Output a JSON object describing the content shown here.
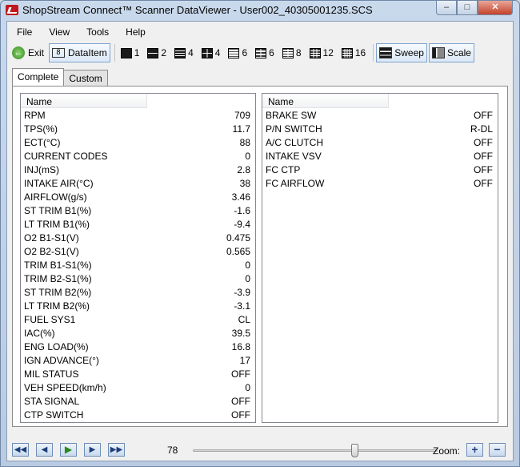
{
  "window": {
    "title": "ShopStream Connect™ Scanner DataViewer - User002_40305001235.SCS",
    "min_glyph": "‒",
    "max_glyph": "□",
    "close_glyph": "✕"
  },
  "menu": [
    "File",
    "View",
    "Tools",
    "Help"
  ],
  "toolbar": {
    "exit_label": "Exit",
    "dataitem_label": "DataItem",
    "layouts": [
      {
        "label": "1",
        "icon": "single-graph-icon"
      },
      {
        "label": "2",
        "icon": "two-graph-icon"
      },
      {
        "label": "4",
        "icon": "four-row-graph-icon"
      },
      {
        "label": "4",
        "icon": "four-grid-graph-icon"
      },
      {
        "label": "6",
        "icon": "six-row-graph-icon"
      },
      {
        "label": "6",
        "icon": "six-grid-graph-icon"
      },
      {
        "label": "8",
        "icon": "eight-grid-graph-icon"
      },
      {
        "label": "12",
        "icon": "twelve-grid-graph-icon"
      },
      {
        "label": "16",
        "icon": "sixteen-grid-graph-icon"
      }
    ],
    "sweep_label": "Sweep",
    "scale_label": "Scale"
  },
  "tabs": [
    "Complete",
    "Custom"
  ],
  "left_panel": {
    "header": "Name",
    "rows": [
      {
        "name": "RPM",
        "value": "709"
      },
      {
        "name": "TPS(%)",
        "value": "11.7"
      },
      {
        "name": "ECT(°C)",
        "value": "88"
      },
      {
        "name": "CURRENT CODES",
        "value": "0"
      },
      {
        "name": "INJ(mS)",
        "value": "2.8"
      },
      {
        "name": "INTAKE AIR(°C)",
        "value": "38"
      },
      {
        "name": "AIRFLOW(g/s)",
        "value": "3.46"
      },
      {
        "name": "ST TRIM B1(%)",
        "value": "-1.6"
      },
      {
        "name": "LT TRIM B1(%)",
        "value": "-9.4"
      },
      {
        "name": "O2 B1-S1(V)",
        "value": "0.475"
      },
      {
        "name": "O2 B2-S1(V)",
        "value": "0.565"
      },
      {
        "name": "TRIM B1-S1(%)",
        "value": "0"
      },
      {
        "name": "TRIM B2-S1(%)",
        "value": "0"
      },
      {
        "name": "ST TRIM B2(%)",
        "value": "-3.9"
      },
      {
        "name": "LT TRIM B2(%)",
        "value": "-3.1"
      },
      {
        "name": "FUEL SYS1",
        "value": "CL"
      },
      {
        "name": "IAC(%)",
        "value": "39.5"
      },
      {
        "name": "ENG LOAD(%)",
        "value": "16.8"
      },
      {
        "name": "IGN ADVANCE(°)",
        "value": "17"
      },
      {
        "name": "MIL STATUS",
        "value": "OFF"
      },
      {
        "name": "VEH SPEED(km/h)",
        "value": "0"
      },
      {
        "name": "STA SIGNAL",
        "value": "OFF"
      },
      {
        "name": "CTP SWITCH",
        "value": "OFF"
      }
    ]
  },
  "right_panel": {
    "header": "Name",
    "rows": [
      {
        "name": "BRAKE SW",
        "value": "OFF"
      },
      {
        "name": "P/N SWITCH",
        "value": "R-DL"
      },
      {
        "name": "A/C CLUTCH",
        "value": "OFF"
      },
      {
        "name": "INTAKE VSV",
        "value": "OFF"
      },
      {
        "name": "FC CTP",
        "value": "OFF"
      },
      {
        "name": "FC AIRFLOW",
        "value": "OFF"
      }
    ]
  },
  "playback": {
    "frame": "78",
    "slider_fraction": 0.66,
    "zoom_label": "Zoom:",
    "buttons": [
      "first-frame",
      "step-back",
      "play",
      "step-forward",
      "last-frame"
    ]
  }
}
